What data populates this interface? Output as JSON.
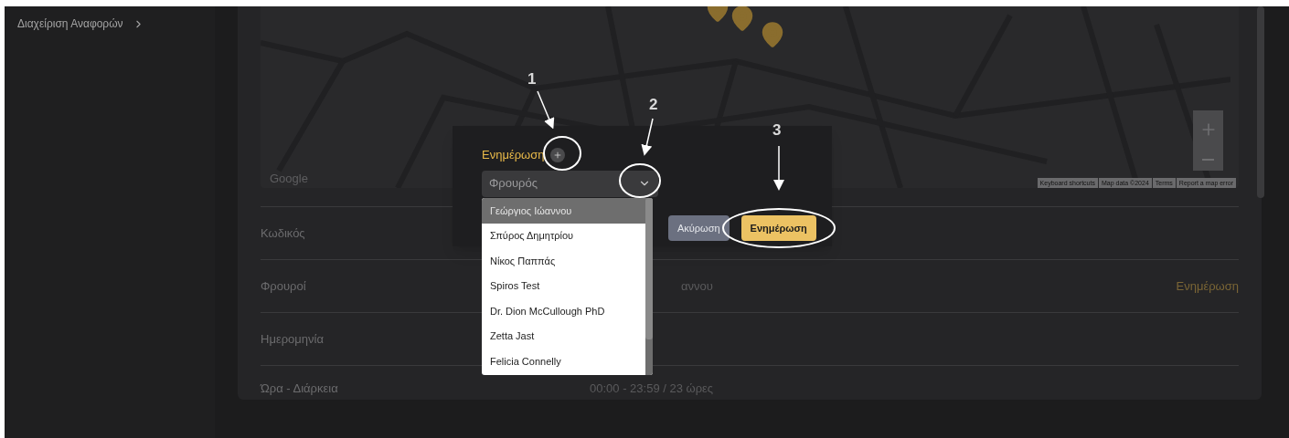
{
  "sidebar": {
    "items": [
      {
        "label": "Διαχείριση Αναφορών",
        "selected": false
      }
    ]
  },
  "map": {
    "brand": "Google",
    "attribution": [
      "Keyboard shortcuts",
      "Map data ©2024",
      "Terms",
      "Report a map error"
    ]
  },
  "details": {
    "rows": [
      {
        "label": "Κωδικός",
        "value": ""
      },
      {
        "label": "Φρουροί",
        "value": "αννου",
        "action": "Ενημέρωση"
      },
      {
        "label": "Ημερομηνία",
        "value": ""
      },
      {
        "label": "Ώρα - Διάρκεια",
        "value": "00:00 - 23:59 / 23 ώρες"
      }
    ]
  },
  "dialog": {
    "title": "Ενημέρωση",
    "select": {
      "placeholder": "Φρουρός"
    },
    "options": [
      {
        "label": "Γεώργιος Ιώαννου",
        "selected": true
      },
      {
        "label": "Σπύρος Δημητρίου",
        "selected": false
      },
      {
        "label": "Νίκος Παππάς",
        "selected": false
      },
      {
        "label": "Spiros Test",
        "selected": false
      },
      {
        "label": "Dr. Dion McCullough PhD",
        "selected": false
      },
      {
        "label": "Zetta Jast",
        "selected": false
      },
      {
        "label": "Felicia Connelly",
        "selected": false
      }
    ],
    "buttons": [
      {
        "label": "Ακύρωση",
        "kind": "secondary"
      },
      {
        "label": "Ενημέρωση",
        "kind": "primary"
      }
    ]
  },
  "annotations": [
    "1",
    "2",
    "3"
  ]
}
